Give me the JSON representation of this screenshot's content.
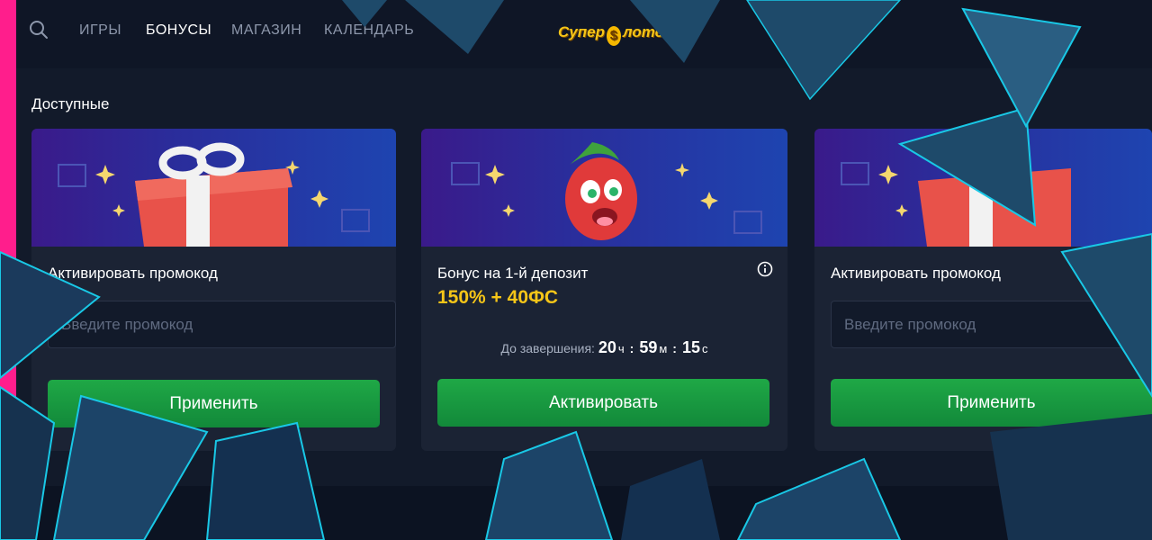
{
  "nav": {
    "items": [
      {
        "label": "ИГРЫ",
        "active": false
      },
      {
        "label": "БОНУСЫ",
        "active": true
      },
      {
        "label": "МАГАЗИН",
        "active": false
      },
      {
        "label": "КАЛЕНДАРЬ",
        "active": false
      }
    ],
    "search_icon": "search-icon"
  },
  "logo": {
    "part1": "Супер",
    "coin": "$",
    "part2": "лотс"
  },
  "section": {
    "title": "Доступные"
  },
  "cards": [
    {
      "title": "Активировать промокод",
      "input_placeholder": "Введите промокод",
      "button_label": "Применить",
      "banner_icon": "gift-box-icon"
    },
    {
      "title": "Бонус на 1-й депозит",
      "value": "150% + 40ФС",
      "timer_label": "До завершения:",
      "timer": {
        "hours": "20",
        "hours_unit": "ч",
        "minutes": "59",
        "minutes_unit": "м",
        "seconds": "15",
        "seconds_unit": "с"
      },
      "button_label": "Активировать",
      "info_icon": "info-icon",
      "banner_icon": "strawberry-character-icon"
    },
    {
      "title": "Активировать промокод",
      "input_placeholder": "Введите промокод",
      "button_label": "Применить",
      "banner_icon": "gift-box-icon"
    }
  ],
  "colors": {
    "accent_gold": "#f5c518",
    "button_green": "#1fa846",
    "frame_pink": "#ff1e8c",
    "frame_cyan": "#19c8e6"
  }
}
